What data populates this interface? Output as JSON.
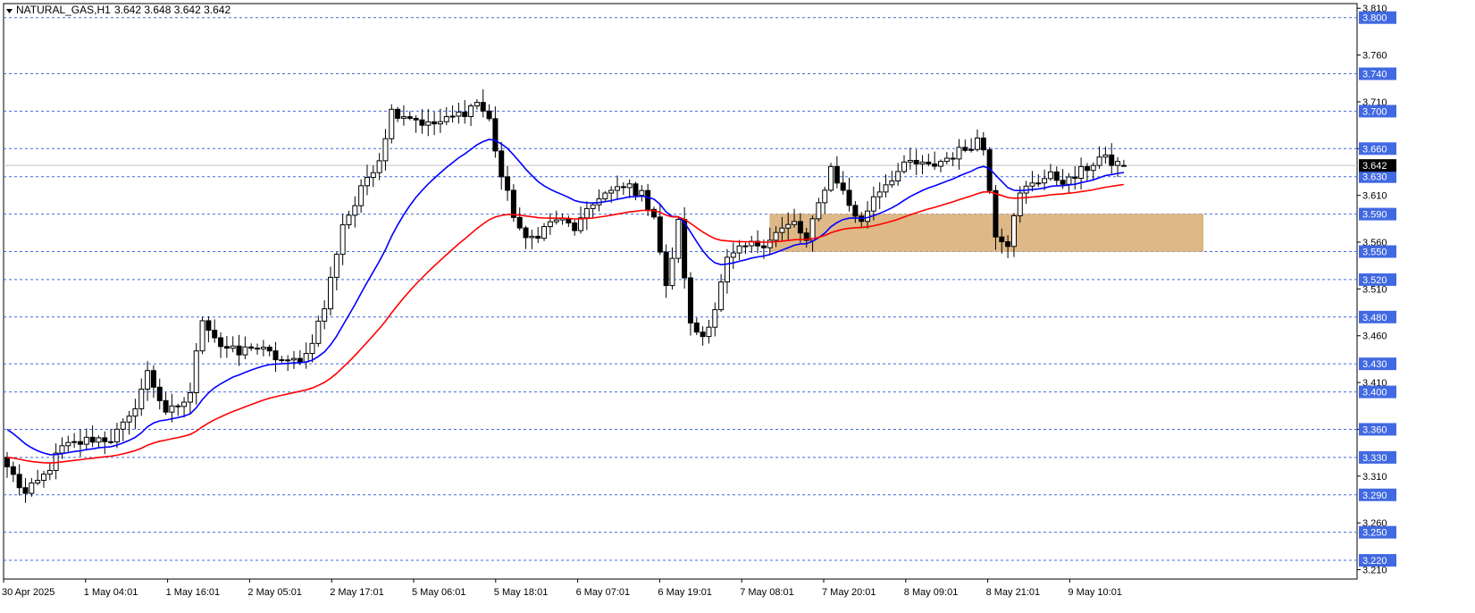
{
  "header": {
    "symbol_label": "NATURAL_GAS,H1",
    "ohlc_label": "3.642 3.648 3.642 3.642"
  },
  "chart_data": {
    "type": "candlestick",
    "symbol": "NATURAL_GAS",
    "timeframe": "H1",
    "ohlc_readout": {
      "open": 3.642,
      "high": 3.648,
      "low": 3.642,
      "close": 3.642
    },
    "current_price": 3.642,
    "ylim": [
      3.2,
      3.815
    ],
    "y_ticks": [
      3.81,
      3.76,
      3.71,
      3.66,
      3.61,
      3.56,
      3.51,
      3.46,
      3.41,
      3.36,
      3.31,
      3.26,
      3.21
    ],
    "x_labels": [
      "30 Apr 2025",
      "1 May 04:01",
      "1 May 16:01",
      "2 May 05:01",
      "2 May 17:01",
      "5 May 06:01",
      "5 May 18:01",
      "6 May 07:01",
      "6 May 19:01",
      "7 May 08:01",
      "7 May 20:01",
      "8 May 09:01",
      "8 May 21:01",
      "9 May 10:01"
    ],
    "level_lines": [
      3.8,
      3.74,
      3.7,
      3.66,
      3.63,
      3.59,
      3.55,
      3.52,
      3.48,
      3.43,
      3.4,
      3.36,
      3.33,
      3.29,
      3.25,
      3.22
    ],
    "level_labels": [
      "3.800",
      "3.740",
      "3.700",
      "3.660",
      "3.630",
      "3.590",
      "3.550",
      "3.520",
      "3.480",
      "3.430",
      "3.400",
      "3.360",
      "3.330",
      "3.290",
      "3.250",
      "3.220"
    ],
    "zone": {
      "from": 3.55,
      "to": 3.59,
      "start_index": 125,
      "end_index": 196
    },
    "waypoints": [
      [
        0,
        3.32
      ],
      [
        3,
        3.29
      ],
      [
        6,
        3.31
      ],
      [
        9,
        3.34
      ],
      [
        14,
        3.35
      ],
      [
        17,
        3.35
      ],
      [
        20,
        3.37
      ],
      [
        23,
        3.42
      ],
      [
        26,
        3.38
      ],
      [
        28,
        3.38
      ],
      [
        30,
        3.4
      ],
      [
        32,
        3.48
      ],
      [
        35,
        3.45
      ],
      [
        38,
        3.44
      ],
      [
        40,
        3.45
      ],
      [
        43,
        3.44
      ],
      [
        46,
        3.43
      ],
      [
        49,
        3.44
      ],
      [
        52,
        3.49
      ],
      [
        55,
        3.58
      ],
      [
        57,
        3.6
      ],
      [
        59,
        3.63
      ],
      [
        61,
        3.65
      ],
      [
        63,
        3.7
      ],
      [
        66,
        3.695
      ],
      [
        69,
        3.685
      ],
      [
        72,
        3.69
      ],
      [
        75,
        3.7
      ],
      [
        77,
        3.71
      ],
      [
        79,
        3.69
      ],
      [
        81,
        3.63
      ],
      [
        83,
        3.59
      ],
      [
        85,
        3.56
      ],
      [
        87,
        3.57
      ],
      [
        90,
        3.585
      ],
      [
        93,
        3.575
      ],
      [
        95,
        3.59
      ],
      [
        97,
        3.61
      ],
      [
        100,
        3.615
      ],
      [
        102,
        3.62
      ],
      [
        104,
        3.61
      ],
      [
        106,
        3.59
      ],
      [
        108,
        3.51
      ],
      [
        110,
        3.58
      ],
      [
        112,
        3.47
      ],
      [
        114,
        3.46
      ],
      [
        116,
        3.49
      ],
      [
        118,
        3.54
      ],
      [
        121,
        3.555
      ],
      [
        124,
        3.56
      ],
      [
        126,
        3.57
      ],
      [
        129,
        3.58
      ],
      [
        131,
        3.56
      ],
      [
        133,
        3.6
      ],
      [
        135,
        3.64
      ],
      [
        138,
        3.6
      ],
      [
        140,
        3.58
      ],
      [
        142,
        3.61
      ],
      [
        145,
        3.63
      ],
      [
        148,
        3.645
      ],
      [
        151,
        3.64
      ],
      [
        154,
        3.65
      ],
      [
        157,
        3.66
      ],
      [
        159,
        3.67
      ],
      [
        160,
        3.66
      ],
      [
        161,
        3.62
      ],
      [
        162,
        3.57
      ],
      [
        164,
        3.56
      ],
      [
        166,
        3.61
      ],
      [
        168,
        3.625
      ],
      [
        171,
        3.63
      ],
      [
        174,
        3.625
      ],
      [
        177,
        3.64
      ],
      [
        179,
        3.65
      ],
      [
        181,
        3.645
      ],
      [
        183,
        3.642
      ]
    ],
    "series": [
      {
        "name": "",
        "color": "#0000ff",
        "period": 20
      },
      {
        "name": "",
        "color": "#ff0000",
        "period": 50
      }
    ]
  },
  "colors": {
    "ma_fast": "#0000ff",
    "ma_slow": "#ff0000",
    "zone_fill": "#deb887",
    "level_line": "#4169e1",
    "level_label_bg": "#4169e1",
    "price_label_bg": "#000000",
    "bull_candle": "#ffffff",
    "bear_candle": "#000000"
  }
}
